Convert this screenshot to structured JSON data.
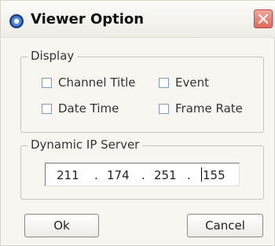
{
  "window": {
    "title": "Viewer Option",
    "icons": {
      "app": "viewer-app-icon",
      "close": "close-icon"
    },
    "accent_close": "#e06a5e"
  },
  "display_group": {
    "title": "Display",
    "options": [
      {
        "label": "Channel Title",
        "checked": false
      },
      {
        "label": "Event",
        "checked": false
      },
      {
        "label": "Date Time",
        "checked": false
      },
      {
        "label": "Frame Rate",
        "checked": false
      }
    ]
  },
  "dynamic_ip_group": {
    "title": "Dynamic IP Server",
    "ip": [
      "211",
      "174",
      "251",
      "155"
    ],
    "separator": "."
  },
  "buttons": {
    "ok": "Ok",
    "cancel": "Cancel"
  }
}
